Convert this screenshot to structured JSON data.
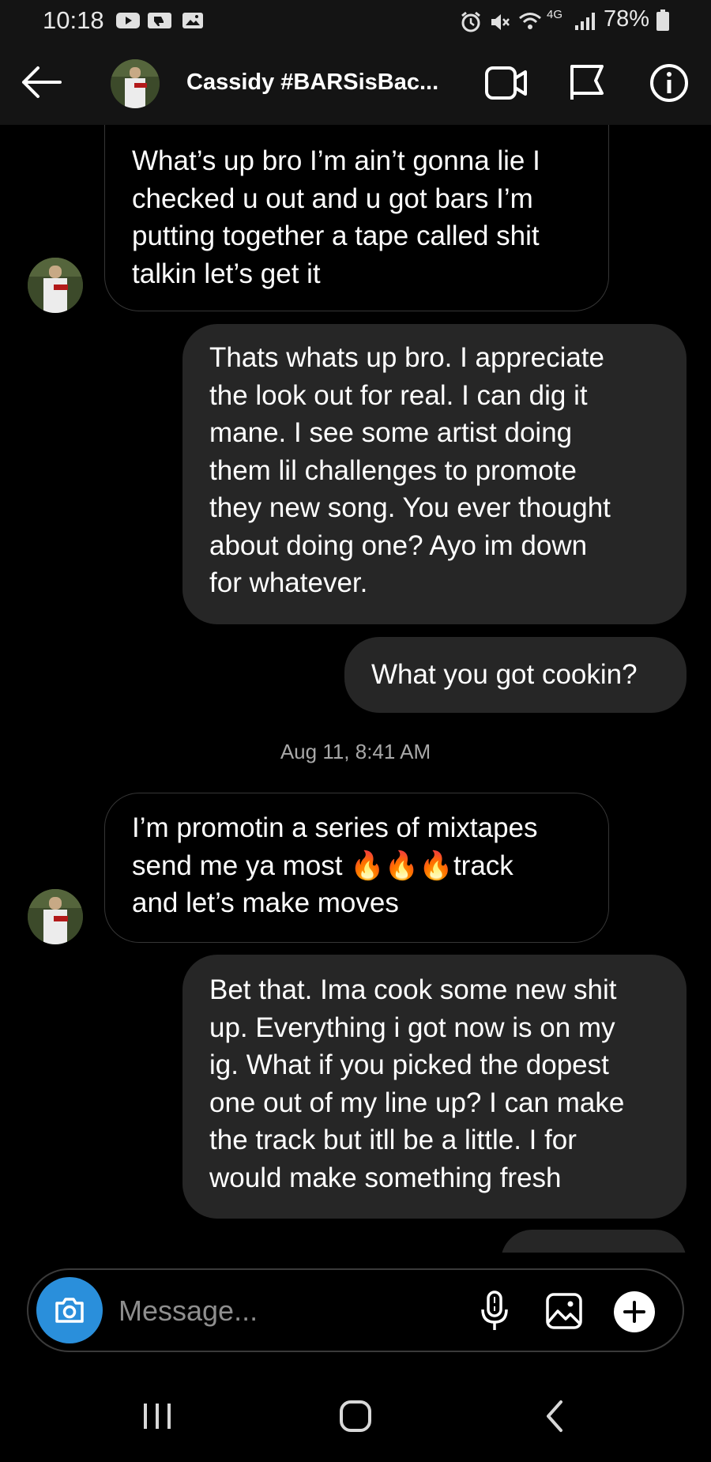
{
  "status_bar": {
    "time": "10:18",
    "network": "4G",
    "battery": "78%"
  },
  "header": {
    "contact_name": "Cassidy #BARSisBac...",
    "icons": [
      "back-arrow-icon",
      "video-call-icon",
      "flag-icon",
      "info-icon"
    ]
  },
  "messages": [
    {
      "direction": "incoming",
      "text": "What’s up bro I’m ain’t gonna lie I\nchecked u out and u got bars I’m\nputting together a tape called shit\ntalkin let’s get it"
    },
    {
      "direction": "outgoing",
      "text": "Thats whats up bro.  I appreciate\nthe look out for real. I can dig it\nmane. I see some artist doing\nthem lil challenges to promote\nthey new song.  You ever thought\nabout doing one? Ayo im down\nfor whatever."
    },
    {
      "direction": "outgoing",
      "text": "What you got cookin?"
    },
    {
      "direction": "incoming",
      "text": "I’m promotin a series of mixtapes\nsend me ya most 🔥🔥🔥track\nand let’s make moves"
    },
    {
      "direction": "outgoing",
      "text": "Bet that. Ima cook some new shit\nup. Everything i got now is on my\nig. What if you picked the dopest\none out of my line up? I can make\nthe track but itll be a little. I for\nwould make something fresh"
    }
  ],
  "timestamp": "Aug 11, 8:41 AM",
  "composer": {
    "placeholder": "Message...",
    "icons": [
      "camera-icon",
      "microphone-icon",
      "gallery-icon",
      "add-icon"
    ]
  },
  "nav_bar": {
    "icons": [
      "recent-apps-icon",
      "home-icon",
      "back-icon"
    ]
  },
  "colors": {
    "background": "#000000",
    "bars": "#141414",
    "outgoing_bubble": "#262626",
    "incoming_border": "#363636",
    "camera_button": "#2a8fdb",
    "secondary_text": "#a8a8a8"
  }
}
